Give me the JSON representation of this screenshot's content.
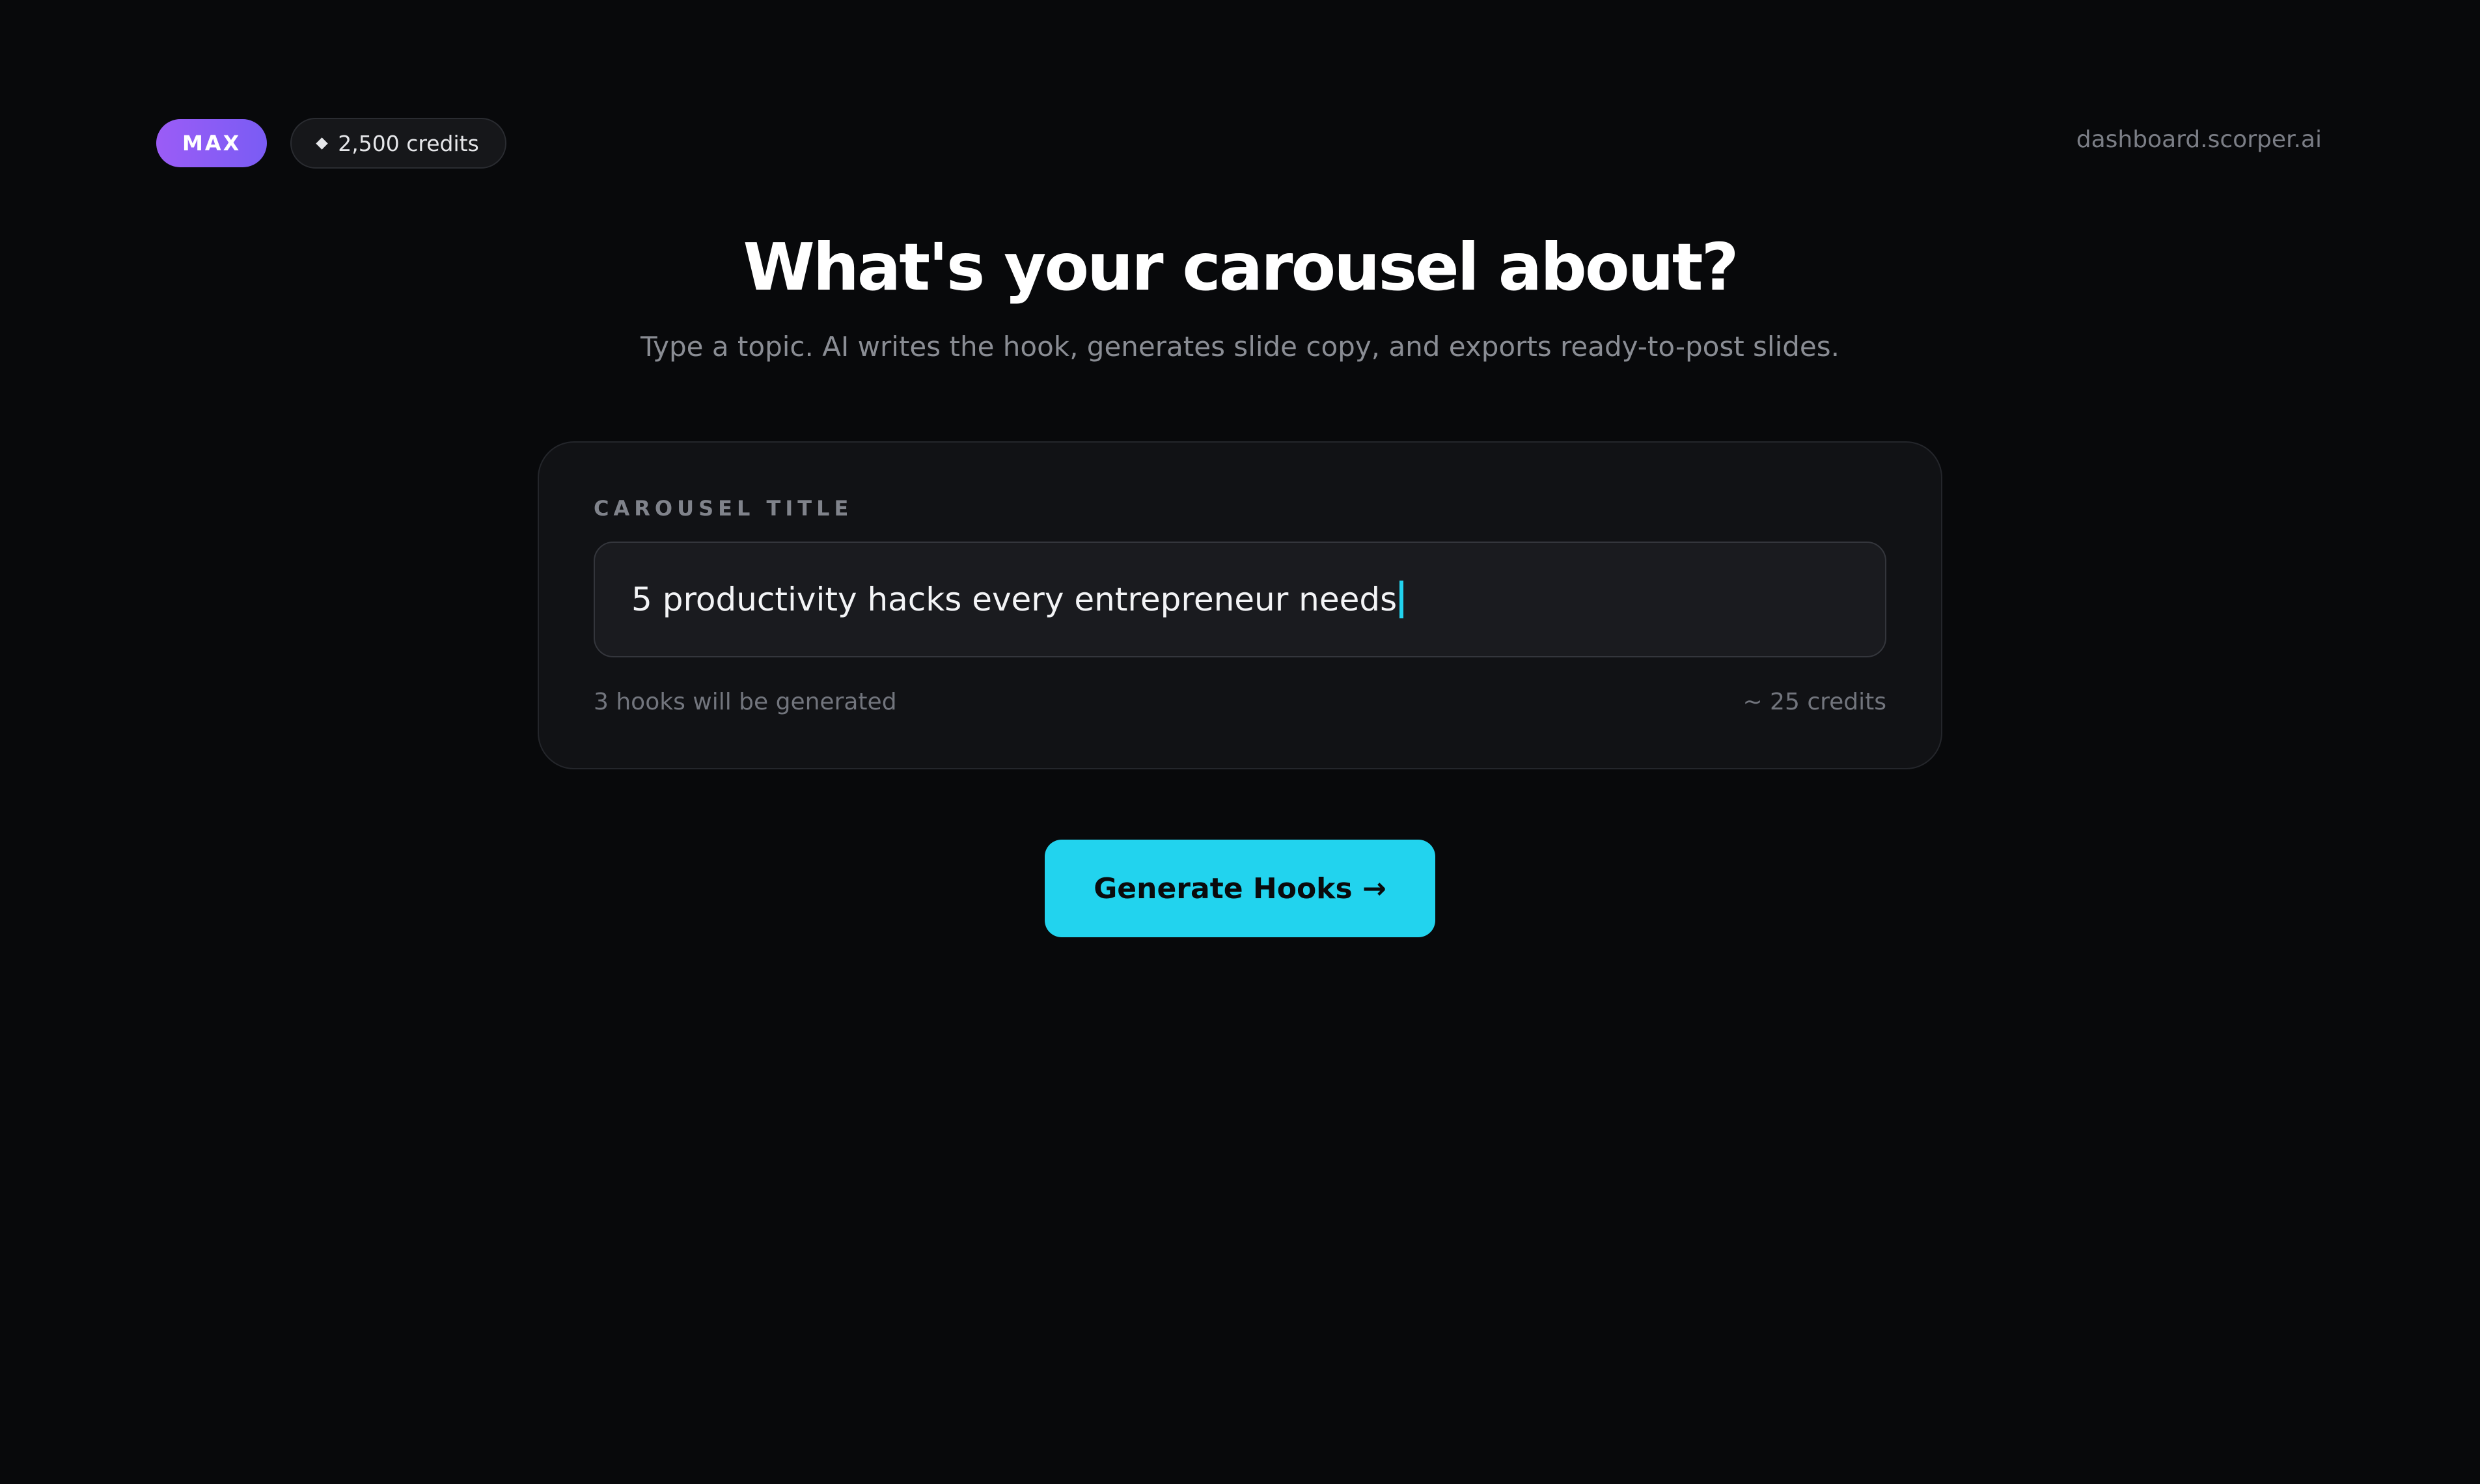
{
  "header": {
    "plan_badge": "MAX",
    "credits": "2,500 credits",
    "credits_icon": "diamond-icon",
    "domain": "dashboard.scorper.ai"
  },
  "hero": {
    "title": "What's your carousel about?",
    "subtitle": "Type a topic. AI writes the hook, generates slide copy, and exports ready-to-post slides."
  },
  "form": {
    "label": "CAROUSEL TITLE",
    "input_value": "5 productivity hacks every entrepreneur needs",
    "hooks_note": "3 hooks will be generated",
    "cost_note": "~ 25 credits"
  },
  "actions": {
    "generate_label": "Generate Hooks →"
  },
  "colors": {
    "background": "#08090b",
    "accent": "#22d3ee",
    "plan_badge": "#8b5cf6"
  }
}
